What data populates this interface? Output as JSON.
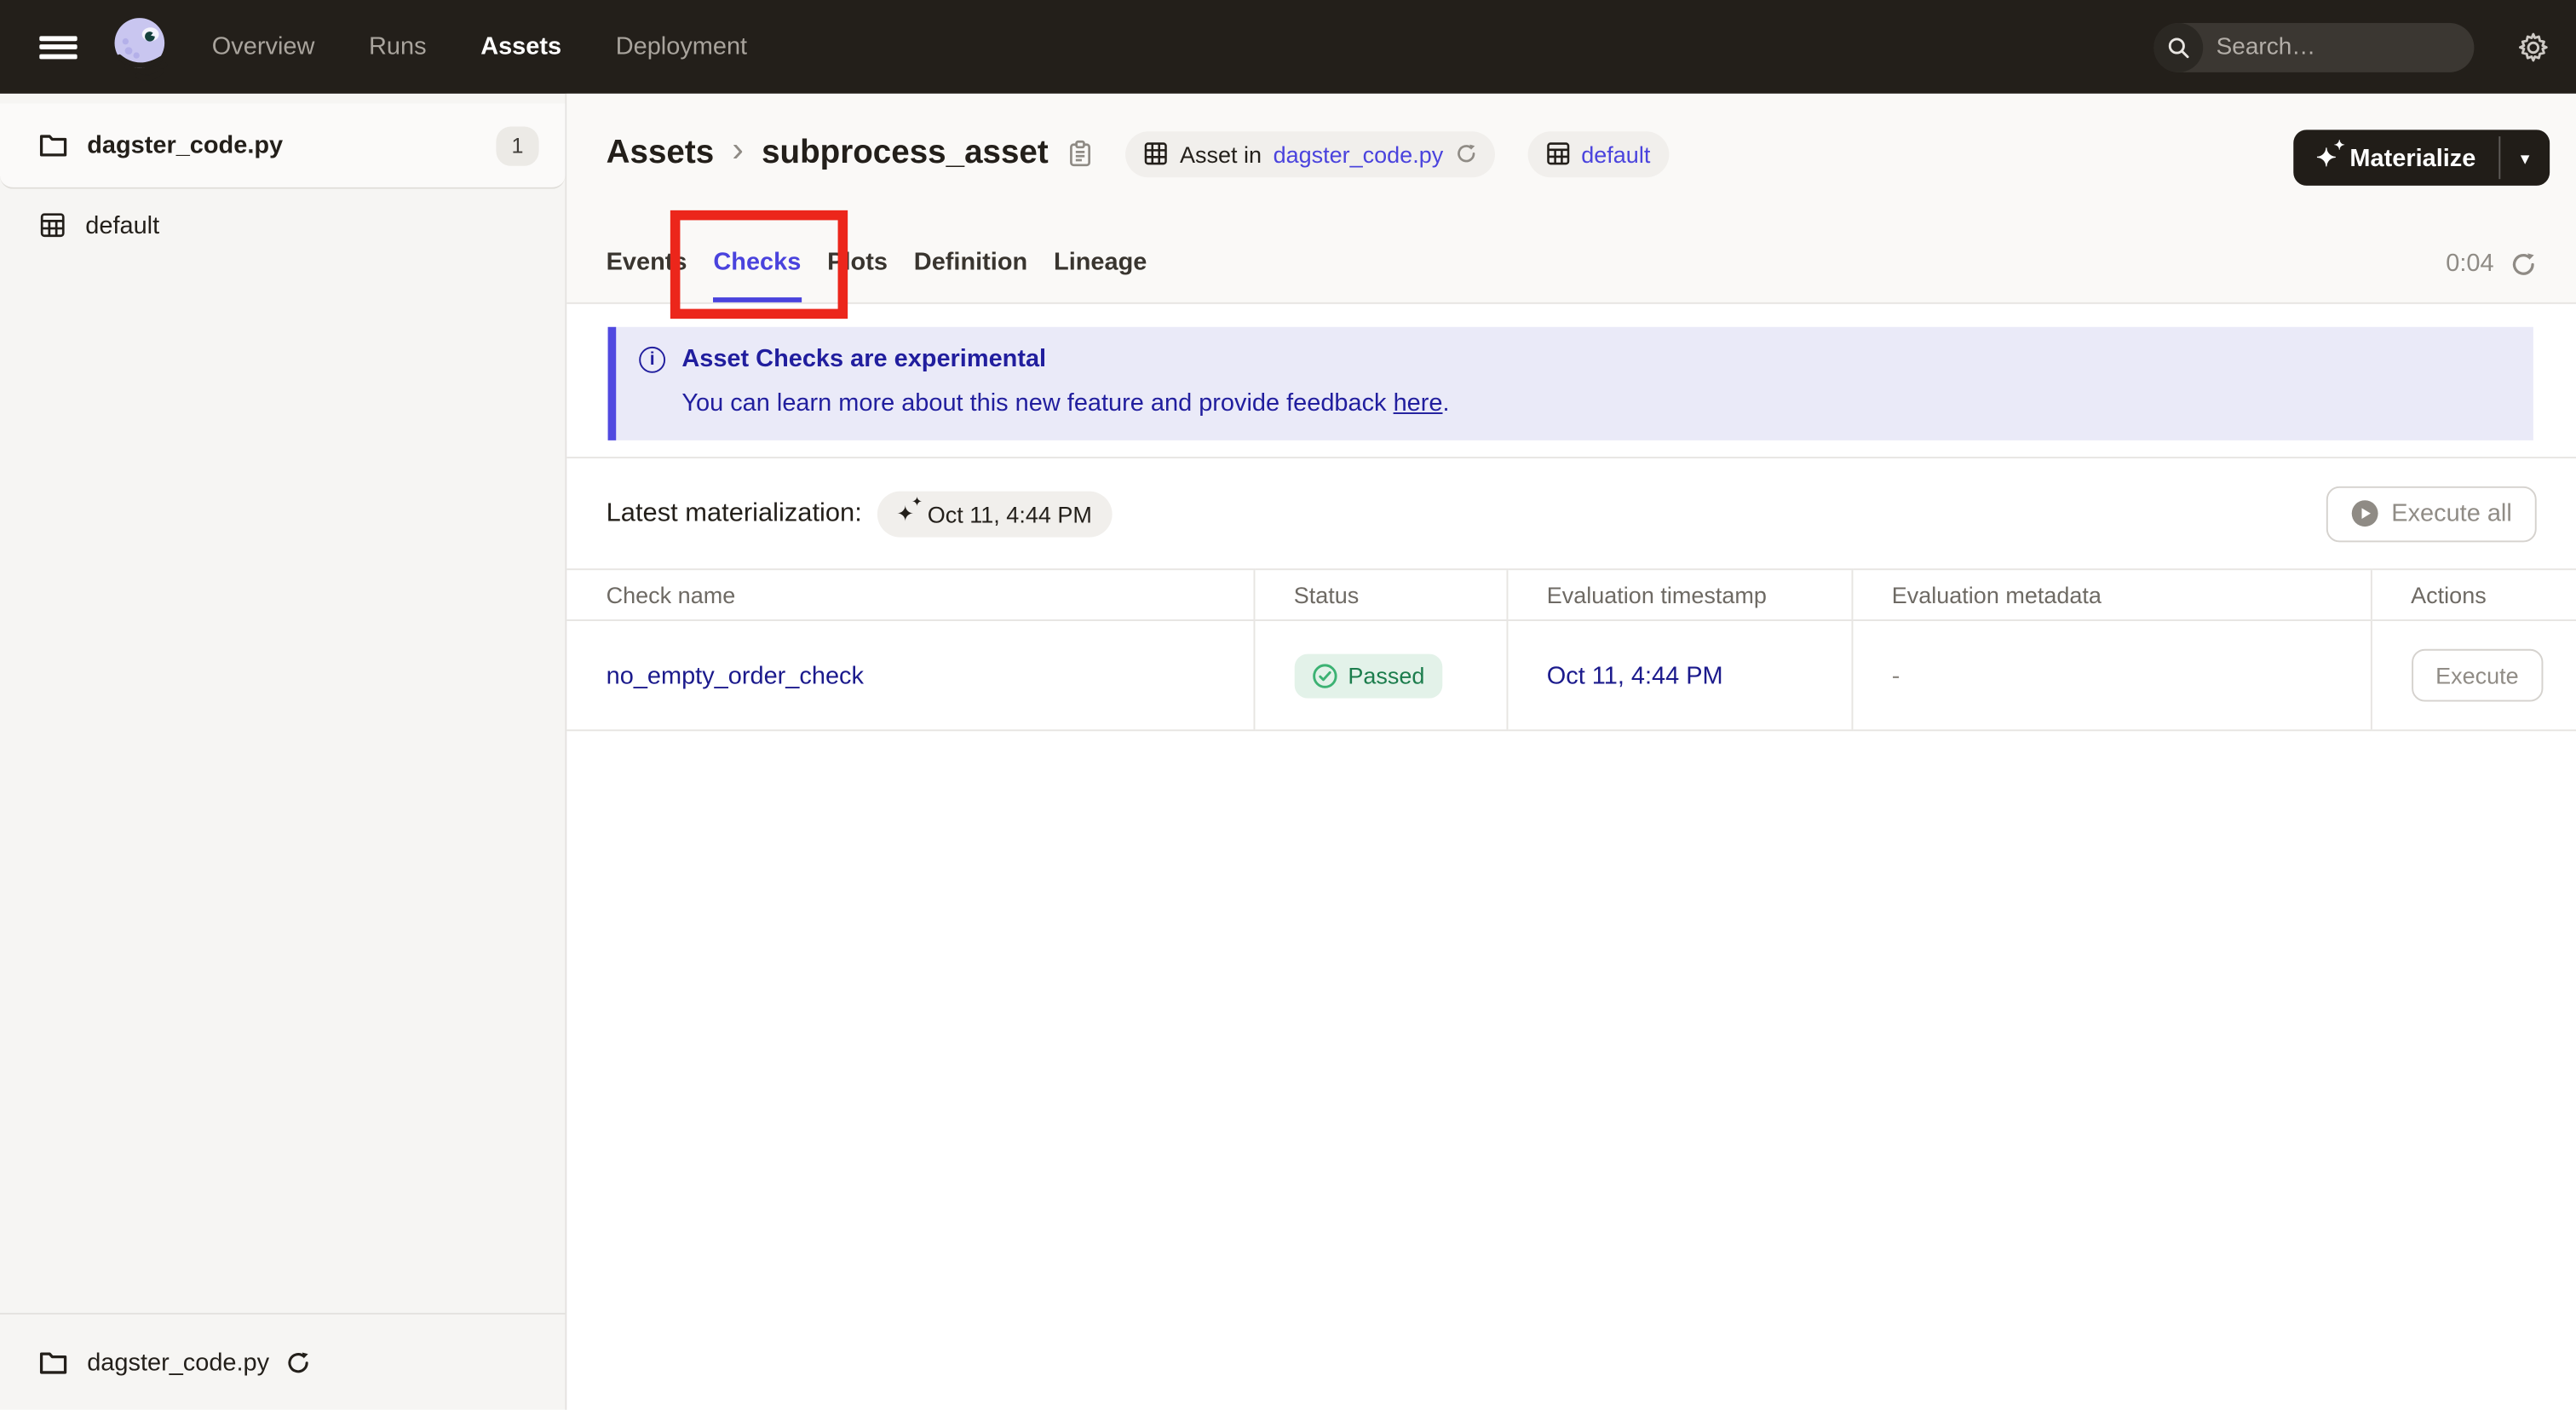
{
  "nav": {
    "items": [
      {
        "label": "Overview",
        "active": false
      },
      {
        "label": "Runs",
        "active": false
      },
      {
        "label": "Assets",
        "active": true
      },
      {
        "label": "Deployment",
        "active": false
      }
    ],
    "search_placeholder": "Search…",
    "search_shortcut": "/"
  },
  "sidebar": {
    "top_items": [
      {
        "label": "dagster_code.py",
        "badge": "1",
        "icon": "folder"
      },
      {
        "label": "default",
        "icon": "asset-group"
      }
    ],
    "bottom_item": {
      "label": "dagster_code.py",
      "icon": "folder"
    }
  },
  "header": {
    "breadcrumb": {
      "root": "Assets",
      "current": "subprocess_asset"
    },
    "chips": [
      {
        "prefix": "Asset in",
        "link": "dagster_code.py"
      },
      {
        "label": "default"
      }
    ],
    "materialize_label": "Materialize"
  },
  "tabs": {
    "items": [
      "Events",
      "Checks",
      "Plots",
      "Definition",
      "Lineage"
    ],
    "active": "Checks",
    "timer": "0:04"
  },
  "banner": {
    "title": "Asset Checks are experimental",
    "body": "You can learn more about this new feature and provide feedback ",
    "link_text": "here",
    "suffix": "."
  },
  "latest": {
    "label": "Latest materialization:",
    "chip": "Oct 11, 4:44 PM",
    "execute_all": "Execute all"
  },
  "table": {
    "columns": [
      "Check name",
      "Status",
      "Evaluation timestamp",
      "Evaluation metadata",
      "Actions"
    ],
    "rows": [
      {
        "name": "no_empty_order_check",
        "status": "Passed",
        "timestamp": "Oct 11, 4:44 PM",
        "metadata": "-",
        "action": "Execute"
      }
    ]
  },
  "icons": {
    "chevron": "›",
    "caret_down": "▾",
    "sparkle": "✦",
    "sparkle_small": "✦",
    "info": "i"
  },
  "colors": {
    "nav_bg": "#231F1A",
    "accent_blurple": "#4A43DD",
    "link_navy": "#1B1A8C",
    "banner_bg": "#EAEAF8",
    "status_green_bg": "#E3F2E9",
    "status_green_text": "#1C7D4D",
    "annotation_red": "#EC261B"
  }
}
